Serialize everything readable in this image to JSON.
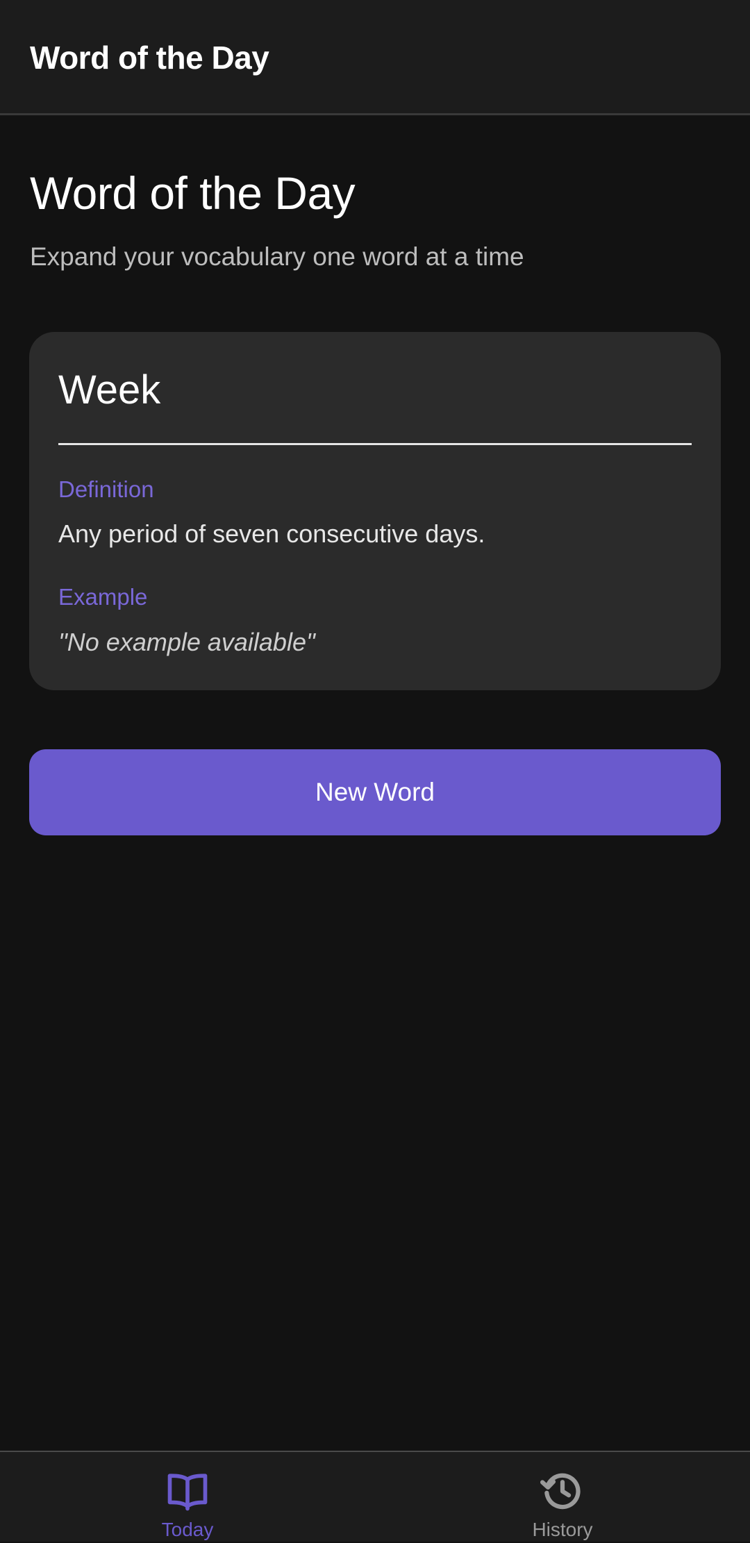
{
  "app_bar": {
    "title": "Word of the Day"
  },
  "header": {
    "title": "Word of the Day",
    "subtitle": "Expand your vocabulary one word at a time"
  },
  "word_card": {
    "word": "Week",
    "definition_label": "Definition",
    "definition": "Any period of seven consecutive days.",
    "example_label": "Example",
    "example": "\"No example available\""
  },
  "actions": {
    "new_word_label": "New Word"
  },
  "bottom_nav": {
    "items": [
      {
        "label": "Today",
        "icon": "book-open-icon",
        "active": true
      },
      {
        "label": "History",
        "icon": "history-icon",
        "active": false
      }
    ]
  },
  "colors": {
    "background": "#121212",
    "surface": "#1c1c1c",
    "card": "#2b2b2b",
    "accent": "#6a5acd",
    "inactive": "#9a9a9a"
  }
}
